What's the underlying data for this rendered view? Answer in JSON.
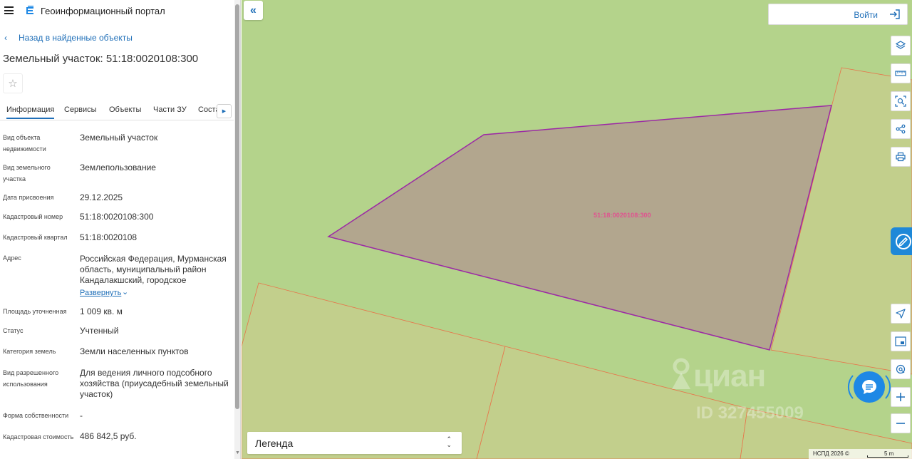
{
  "app": {
    "title": "Геоинформационный портал"
  },
  "nav": {
    "back_label": "Назад в найденные объекты"
  },
  "page": {
    "title": "Земельный участок: 51:18:0020108:300"
  },
  "tabs": [
    {
      "label": "Информация",
      "active": true
    },
    {
      "label": "Сервисы"
    },
    {
      "label": "Объекты"
    },
    {
      "label": "Части ЗУ"
    },
    {
      "label": "Соста"
    }
  ],
  "properties": [
    {
      "label": "Вид объекта недвижимости",
      "value": "Земельный участок"
    },
    {
      "label": "Вид земельного участка",
      "value": "Землепользование"
    },
    {
      "label": "Дата присвоения",
      "value": "29.12.2025"
    },
    {
      "label": "Кадастровый номер",
      "value": "51:18:0020108:300"
    },
    {
      "label": "Кадастровый квартал",
      "value": "51:18:0020108"
    },
    {
      "label": "Адрес",
      "value": "Российская Федерация, Мурманская область, муниципальный район Кандалакшский, городское"
    },
    {
      "label": "Площадь уточненная",
      "value": "1 009 кв. м"
    },
    {
      "label": "Статус",
      "value": "Учтенный"
    },
    {
      "label": "Категория земель",
      "value": "Земли населенных пунктов"
    },
    {
      "label": "Вид разрешенного использования",
      "value": "Для ведения личного подсобного хозяйства (приусадебный земельный участок)"
    },
    {
      "label": "Форма собственности",
      "value": "-"
    },
    {
      "label": "Кадастровая стоимость",
      "value": "486 842,5 руб."
    }
  ],
  "address_expand_label": "Развернуть",
  "map": {
    "login_label": "Войти",
    "parcel_label": "51:18:0020108:300",
    "legend_label": "Легенда",
    "attribution": "НСПД 2026 ©",
    "scale_label": "5 m",
    "watermark_brand": "циан",
    "watermark_id": "ID 327455009",
    "tools": [
      "layers-icon",
      "ruler-icon",
      "select-area-icon",
      "share-icon",
      "print-icon"
    ],
    "nav_tools": [
      "locate-icon",
      "minimap-icon",
      "geolocation-icon",
      "zoom-in-icon",
      "zoom-out-icon"
    ]
  },
  "colors": {
    "accent": "#1f6fb8",
    "map_bg": "#b4d38b",
    "parcel_fill": "#b2a68e",
    "parcel_stroke": "#9c2aa5",
    "neighbor_stroke": "#e8744a",
    "parcel_label": "#e0528f"
  }
}
